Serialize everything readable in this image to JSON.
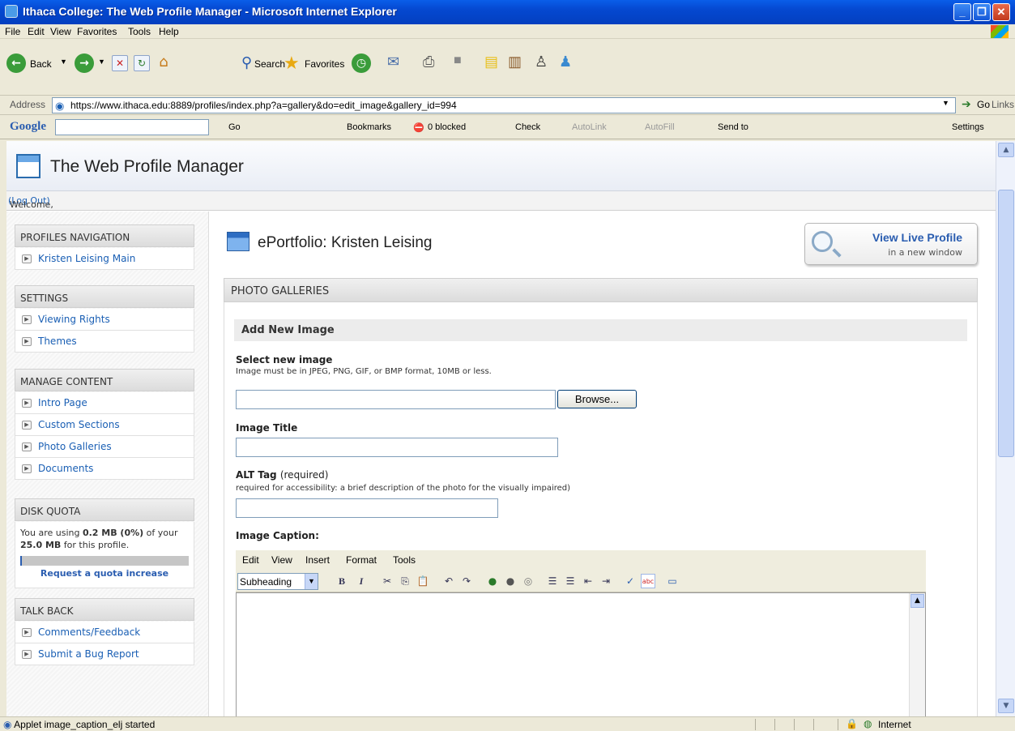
{
  "window": {
    "title": "Ithaca College: The Web Profile Manager - Microsoft Internet Explorer"
  },
  "menubar": {
    "items": [
      "File",
      "Edit",
      "View",
      "Favorites",
      "Tools",
      "Help"
    ]
  },
  "toolbar": {
    "back": "Back",
    "search": "Search",
    "favorites": "Favorites"
  },
  "address": {
    "label": "Address",
    "url": "https://www.ithaca.edu:8889/profiles/index.php?a=gallery&do=edit_image&gallery_id=994",
    "go": "Go",
    "links": "Links"
  },
  "googlebar": {
    "logo": "Google",
    "go": "Go",
    "bookmarks": "Bookmarks",
    "blocked": "0 blocked",
    "check": "Check",
    "autolink": "AutoLink",
    "autofill": "AutoFill",
    "sendto": "Send to",
    "settings": "Settings"
  },
  "app": {
    "title": "The Web Profile Manager",
    "welcome": "Welcome, Kristen.",
    "logout": "(Log Out)"
  },
  "sidebar": {
    "sections": [
      {
        "title": "PROFILES NAVIGATION",
        "items": [
          "Kristen Leising Main"
        ]
      },
      {
        "title": "SETTINGS",
        "items": [
          "Viewing Rights",
          "Themes"
        ]
      },
      {
        "title": "MANAGE CONTENT",
        "items": [
          "Intro Page",
          "Custom Sections",
          "Photo Galleries",
          "Documents"
        ]
      },
      {
        "title": "DISK QUOTA",
        "items": []
      },
      {
        "title": "TALK BACK",
        "items": [
          "Comments/Feedback",
          "Submit a Bug Report"
        ]
      }
    ],
    "quota": {
      "prefix": "You are using ",
      "used": "0.2 MB (0%)",
      "middle": " of your ",
      "total": "25.0 MB",
      "suffix": " for this profile.",
      "fraction": 0.0,
      "link": "Request a quota increase"
    }
  },
  "main": {
    "page_title": "ePortfolio: Kristen Leising",
    "view_live": {
      "title": "View Live Profile",
      "subtitle": "in a new window"
    },
    "section": "PHOTO GALLERIES",
    "subsection": "Add New Image",
    "select_image": {
      "label": "Select new image",
      "hint": "Image must be in JPEG, PNG, GIF, or BMP format, 10MB or less.",
      "browse": "Browse..."
    },
    "image_title": {
      "label": "Image Title"
    },
    "alt_tag": {
      "label": "ALT Tag",
      "label_suffix": "(required)",
      "hint": "required for accessibility: a brief description of the photo for the visually impaired)"
    },
    "caption": {
      "label": "Image Caption:"
    },
    "editor": {
      "menu": [
        "Edit",
        "View",
        "Insert",
        "Format",
        "Tools"
      ],
      "style": "Subheading"
    }
  },
  "status": {
    "text": "Applet image_caption_elj started",
    "zone": "Internet"
  }
}
